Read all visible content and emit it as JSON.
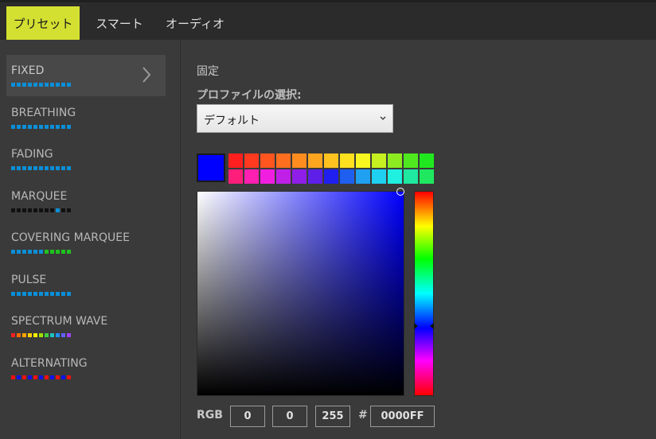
{
  "tabs": [
    {
      "label": "プリセット",
      "active": true
    },
    {
      "label": "スマート",
      "active": false
    },
    {
      "label": "オーディオ",
      "active": false
    }
  ],
  "effects": [
    {
      "label": "FIXED",
      "active": true,
      "dots": [
        "#0a8fd8",
        "#0a8fd8",
        "#0a8fd8",
        "#0a8fd8",
        "#0a8fd8",
        "#0a8fd8",
        "#0a8fd8",
        "#0a8fd8",
        "#0a8fd8",
        "#0a8fd8",
        "#0a8fd8"
      ]
    },
    {
      "label": "BREATHING",
      "active": false,
      "dots": [
        "#0a8fd8",
        "#0a8fd8",
        "#0a8fd8",
        "#0a8fd8",
        "#0a8fd8",
        "#0a8fd8",
        "#0a8fd8",
        "#0a8fd8",
        "#0a8fd8",
        "#0a8fd8",
        "#0a8fd8"
      ]
    },
    {
      "label": "FADING",
      "active": false,
      "dots": [
        "#0a8fd8",
        "#0a8fd8",
        "#0a8fd8",
        "#0a8fd8",
        "#0a8fd8",
        "#0a8fd8",
        "#0a8fd8",
        "#0a8fd8",
        "#0a8fd8",
        "#0a8fd8",
        "#0a8fd8"
      ]
    },
    {
      "label": "MARQUEE",
      "active": false,
      "dots": [
        "#111111",
        "#111111",
        "#111111",
        "#111111",
        "#111111",
        "#111111",
        "#111111",
        "#111111",
        "#0a8fd8",
        "#111111",
        "#111111"
      ]
    },
    {
      "label": "COVERING MARQUEE",
      "active": false,
      "dots": [
        "#0a8fd8",
        "#0a8fd8",
        "#0a8fd8",
        "#0a8fd8",
        "#0a8fd8",
        "#0a8fd8",
        "#1fc21f",
        "#1fc21f",
        "#1fc21f",
        "#1fc21f",
        "#1fc21f"
      ]
    },
    {
      "label": "PULSE",
      "active": false,
      "dots": [
        "#0a8fd8",
        "#0a8fd8",
        "#0a8fd8",
        "#0a8fd8",
        "#0a8fd8",
        "#0a8fd8",
        "#0a8fd8",
        "#0a8fd8",
        "#0a8fd8",
        "#0a8fd8",
        "#0a8fd8"
      ]
    },
    {
      "label": "SPECTRUM WAVE",
      "active": false,
      "dots": [
        "#ff2020",
        "#ff6a00",
        "#ffa500",
        "#ffd400",
        "#f0f000",
        "#a0e000",
        "#40d040",
        "#20c0c0",
        "#2090ff",
        "#6060ff",
        "#a040ff"
      ]
    },
    {
      "label": "ALTERNATING",
      "active": false,
      "dots": [
        "#ee1111",
        "#1111ee",
        "#ee1111",
        "#1111ee",
        "#ee1111",
        "#1111ee",
        "#ee1111",
        "#1111ee",
        "#ee1111",
        "#1111ee",
        "#ee1111"
      ]
    }
  ],
  "panel": {
    "heading": "固定",
    "profile_label": "プロファイルの選択:",
    "profile_value": "デフォルト"
  },
  "color": {
    "current": "#0000ff",
    "palette_row1": [
      "#ff1f1f",
      "#ff3a1f",
      "#ff551f",
      "#ff6f1f",
      "#ff8c1f",
      "#ffa51f",
      "#ffc21f",
      "#ffe01f",
      "#f7f71f",
      "#c6f01f",
      "#8cec1f",
      "#4fe81f",
      "#1fe81f"
    ],
    "palette_row2": [
      "#ff1f7a",
      "#ff1fb0",
      "#f01fe0",
      "#c01fe8",
      "#8f1fe8",
      "#5e1fe8",
      "#1f1ff0",
      "#1f5ff0",
      "#1fa0f0",
      "#1fd0f0",
      "#1ff0e0",
      "#1fe8a0",
      "#1fe860"
    ],
    "rgb_label": "RGB",
    "r": "0",
    "g": "0",
    "b": "255",
    "hash": "#",
    "hex": "0000FF"
  }
}
